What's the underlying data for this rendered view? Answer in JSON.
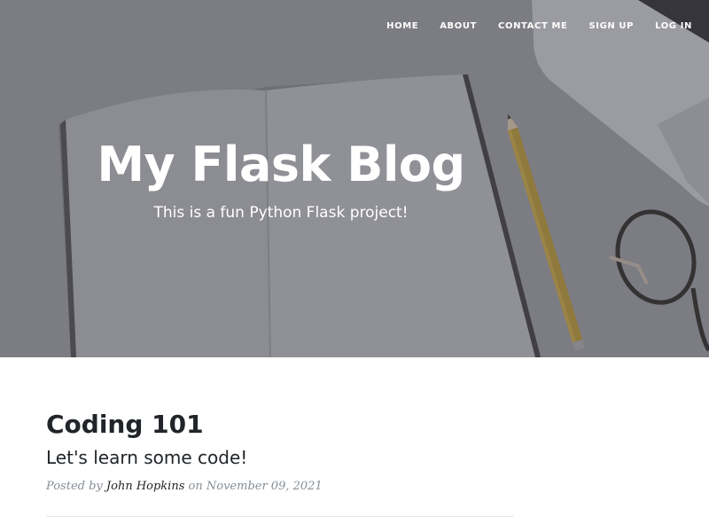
{
  "navbar": {
    "links": [
      {
        "label": "HOME"
      },
      {
        "label": "ABOUT"
      },
      {
        "label": "CONTACT ME"
      },
      {
        "label": "SIGN UP"
      },
      {
        "label": "LOG IN"
      }
    ]
  },
  "header": {
    "title": "My Flask Blog",
    "subtitle": "This is a fun Python Flask project!"
  },
  "posts": [
    {
      "title": "Coding 101",
      "subtitle": "Let's learn some code!",
      "meta_prefix": "Posted by",
      "author": "John Hopkins",
      "meta_on": "on",
      "date": "November 09, 2021"
    }
  ],
  "colors": {
    "heading_text": "#212529",
    "meta_text": "#868e96",
    "hero_text": "#ffffff"
  }
}
